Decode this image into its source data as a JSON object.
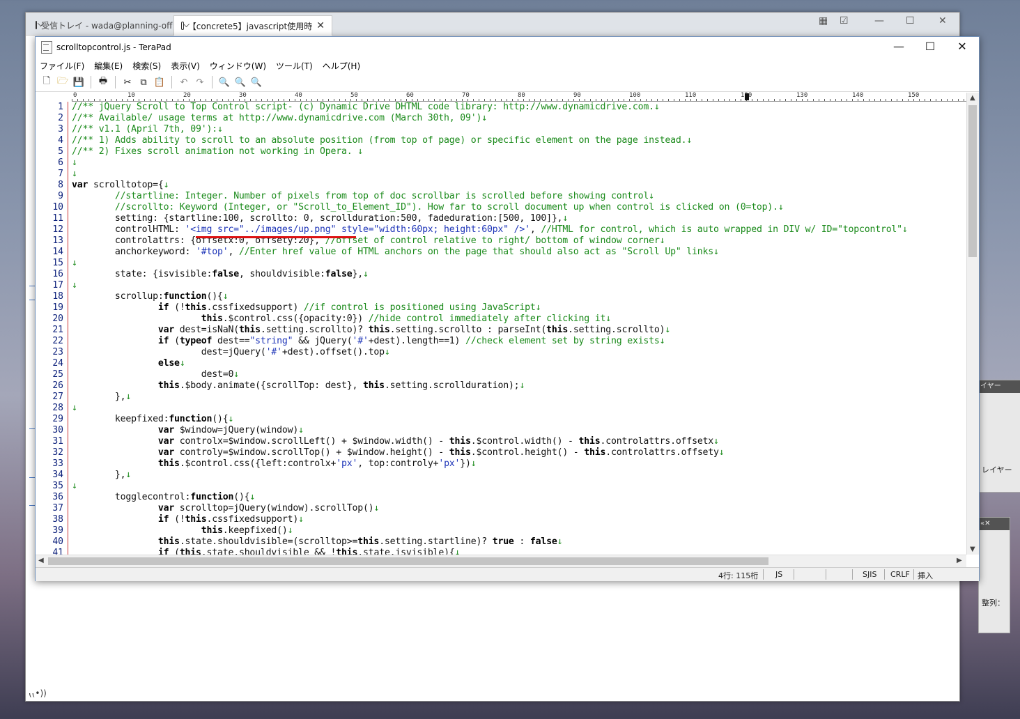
{
  "browser": {
    "tabs": [
      {
        "label": "受信トレイ - wada@planning-off",
        "active": false
      },
      {
        "label": "【concrete5】javascript使用時",
        "active": true
      }
    ]
  },
  "side_panel": {
    "layer_label_top": "イヤー",
    "layer_label_bottom": "レイヤー",
    "align_label": "整列："
  },
  "terapad": {
    "title": "scrolltopcontrol.js - TeraPad",
    "menu": [
      "ファイル(F)",
      "編集(E)",
      "検索(S)",
      "表示(V)",
      "ウィンドウ(W)",
      "ツール(T)",
      "ヘルプ(H)"
    ],
    "toolbar_icons": [
      "new-file-icon",
      "open-folder-icon",
      "save-icon",
      "print-icon",
      "cut-icon",
      "copy-icon",
      "paste-icon",
      "undo-icon",
      "redo-icon",
      "find-icon",
      "find-next-icon",
      "find-prev-icon"
    ],
    "ruler_labels": [
      "0",
      "10",
      "20",
      "30",
      "40",
      "50",
      "60",
      "70",
      "80",
      "90",
      "100",
      "110",
      "120",
      "130",
      "140",
      "150"
    ],
    "status": {
      "position": "4行: 115桁",
      "filetype": "JS",
      "encoding": "SJIS",
      "linebreak": "CRLF",
      "mode": "挿入"
    },
    "code_lines": [
      "//** jQuery Scroll to Top Control script- (c) Dynamic Drive DHTML code library: http://www.dynamicdrive.com.↓",
      "//** Available/ usage terms at http://www.dynamicdrive.com (March 30th, 09')↓",
      "//** v1.1 (April 7th, 09'):↓",
      "//** 1) Adds ability to scroll to an absolute position (from top of page) or specific element on the page instead.↓",
      "//** 2) Fixes scroll animation not working in Opera. ↓",
      "↓",
      "↓",
      "var scrolltotop={↓",
      "        //startline: Integer. Number of pixels from top of doc scrollbar is scrolled before showing control↓",
      "        //scrollto: Keyword (Integer, or \"Scroll_to_Element_ID\"). How far to scroll document up when control is clicked on (0=top).↓",
      "        setting: {startline:100, scrollto: 0, scrollduration:500, fadeduration:[500, 100]},↓",
      "        controlHTML: '<img src=\"../images/up.png\" style=\"width:60px; height:60px\" />', //HTML for control, which is auto wrapped in DIV w/ ID=\"topcontrol\"↓",
      "        controlattrs: {offsetx:0, offsety:20}, //offset of control relative to right/ bottom of window corner↓",
      "        anchorkeyword: '#top', //Enter href value of HTML anchors on the page that should also act as \"Scroll Up\" links↓",
      "↓",
      "        state: {isvisible:false, shouldvisible:false},↓",
      "↓",
      "        scrollup:function(){↓",
      "                if (!this.cssfixedsupport) //if control is positioned using JavaScript↓",
      "                        this.$control.css({opacity:0}) //hide control immediately after clicking it↓",
      "                var dest=isNaN(this.setting.scrollto)? this.setting.scrollto : parseInt(this.setting.scrollto)↓",
      "                if (typeof dest==\"string\" && jQuery('#'+dest).length==1) //check element set by string exists↓",
      "                        dest=jQuery('#'+dest).offset().top↓",
      "                else↓",
      "                        dest=0↓",
      "                this.$body.animate({scrollTop: dest}, this.setting.scrollduration);↓",
      "        },↓",
      "↓",
      "        keepfixed:function(){↓",
      "                var $window=jQuery(window)↓",
      "                var controlx=$window.scrollLeft() + $window.width() - this.$control.width() - this.controlattrs.offsetx↓",
      "                var controly=$window.scrollTop() + $window.height() - this.$control.height() - this.controlattrs.offsety↓",
      "                this.$control.css({left:controlx+'px', top:controly+'px'})↓",
      "        },↓",
      "↓",
      "        togglecontrol:function(){↓",
      "                var scrolltop=jQuery(window).scrollTop()↓",
      "                if (!this.cssfixedsupport)↓",
      "                        this.keepfixed()↓",
      "                this.state.shouldvisible=(scrolltop>=this.setting.startline)? true : false↓",
      "                if (this.state.shouldvisible && !this.state.isvisible){↓"
    ]
  }
}
